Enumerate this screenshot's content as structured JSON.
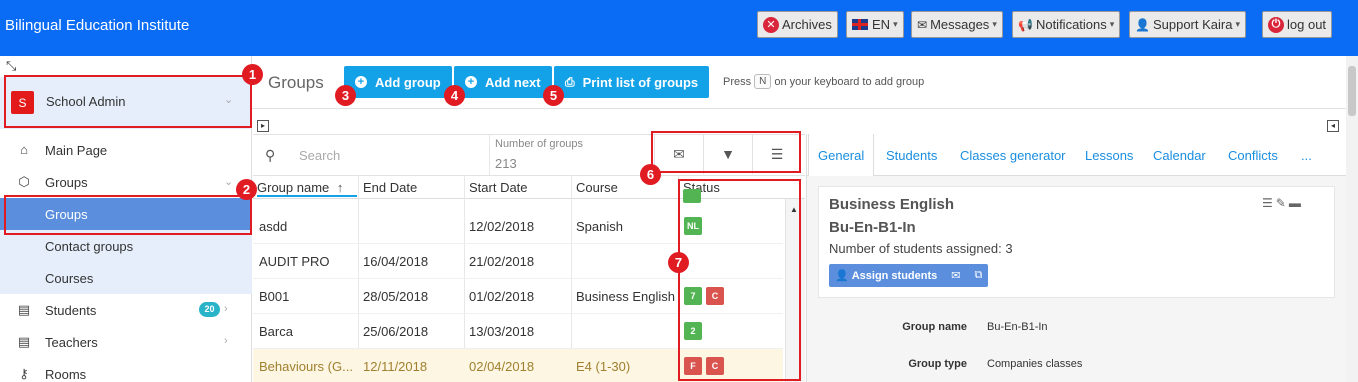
{
  "app": {
    "brand": "Bilingual Education Institute"
  },
  "topbar": {
    "archives": "Archives",
    "language": "EN",
    "messages": "Messages",
    "notifications": "Notifications",
    "user": "Support Kaira",
    "logout": "log out"
  },
  "sidebar": {
    "school_badge": "S",
    "school": "School Admin",
    "items": [
      {
        "label": "Main Page",
        "icon": "home-icon"
      },
      {
        "label": "Groups",
        "icon": "cube-icon"
      },
      {
        "label": "Groups",
        "icon": ""
      },
      {
        "label": "Contact groups",
        "icon": ""
      },
      {
        "label": "Courses",
        "icon": ""
      },
      {
        "label": "Students",
        "icon": "id-card-icon",
        "badge": "20"
      },
      {
        "label": "Teachers",
        "icon": "id-card-icon"
      },
      {
        "label": "Rooms",
        "icon": "key-icon"
      }
    ]
  },
  "toolbar": {
    "page_title": "Groups",
    "add_group": "Add group",
    "add_next": "Add next",
    "print_list": "Print list of groups",
    "press": "Press",
    "key": "N",
    "hint": "on your keyboard to add group"
  },
  "list": {
    "search_placeholder": "Search",
    "num_groups_label": "Number of groups",
    "num_groups": "213",
    "columns": {
      "name": "Group name",
      "end": "End Date",
      "start": "Start Date",
      "course": "Course",
      "status": "Status"
    },
    "rows": [
      {
        "name": "asdd",
        "end": "",
        "start": "12/02/2018",
        "course": "Spanish",
        "status": [
          "NL"
        ]
      },
      {
        "name": "AUDIT PRO",
        "end": "16/04/2018",
        "start": "21/02/2018",
        "course": "",
        "status": []
      },
      {
        "name": "B001",
        "end": "28/05/2018",
        "start": "01/02/2018",
        "course": "Business English",
        "status": [
          "7",
          "C"
        ]
      },
      {
        "name": "Barca",
        "end": "25/06/2018",
        "start": "13/03/2018",
        "course": "",
        "status": [
          "2"
        ]
      },
      {
        "name": "Behaviours (G...",
        "end": "12/11/2018",
        "start": "02/04/2018",
        "course": "E4 (1-30)",
        "status": [
          "F",
          "C"
        ]
      }
    ]
  },
  "detail": {
    "tabs": [
      "General",
      "Students",
      "Classes generator",
      "Lessons",
      "Calendar",
      "Conflicts",
      "..."
    ],
    "title": "Business English",
    "code": "Bu-En-B1-In",
    "students_assigned": "Number of students assigned: 3",
    "assign_label": "Assign students",
    "props": [
      {
        "label": "Group name",
        "value": "Bu-En-B1-In"
      },
      {
        "label": "Group type",
        "value": "Companies classes"
      }
    ]
  },
  "annotations": [
    "1",
    "2",
    "3",
    "4",
    "5",
    "6",
    "7"
  ],
  "colors": {
    "topbar": "#0a6cf5",
    "button": "#13a2e8",
    "annotation": "#e01b22",
    "active_nav": "#5b8fdd"
  }
}
